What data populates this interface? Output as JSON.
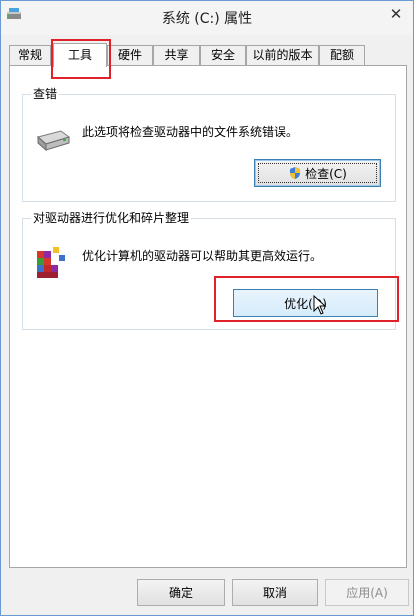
{
  "window": {
    "title": "系统 (C:) 属性",
    "close_glyph": "✕"
  },
  "tabs": [
    {
      "label": "常规"
    },
    {
      "label": "工具"
    },
    {
      "label": "硬件"
    },
    {
      "label": "共享"
    },
    {
      "label": "安全"
    },
    {
      "label": "以前的版本"
    },
    {
      "label": "配额"
    }
  ],
  "check_group": {
    "title": "查错",
    "description": "此选项将检查驱动器中的文件系统错误。",
    "button_label": "检查(C)",
    "icon": "drive-icon"
  },
  "optimize_group": {
    "title": "对驱动器进行优化和碎片整理",
    "description": "优化计算机的驱动器可以帮助其更高效运行。",
    "button_label": "优化(O)",
    "icon": "defrag-icon"
  },
  "footer": {
    "ok_label": "确定",
    "cancel_label": "取消",
    "apply_label": "应用(A)"
  },
  "colors": {
    "highlight": "#e0232a",
    "accent": "#3c7fb1"
  }
}
